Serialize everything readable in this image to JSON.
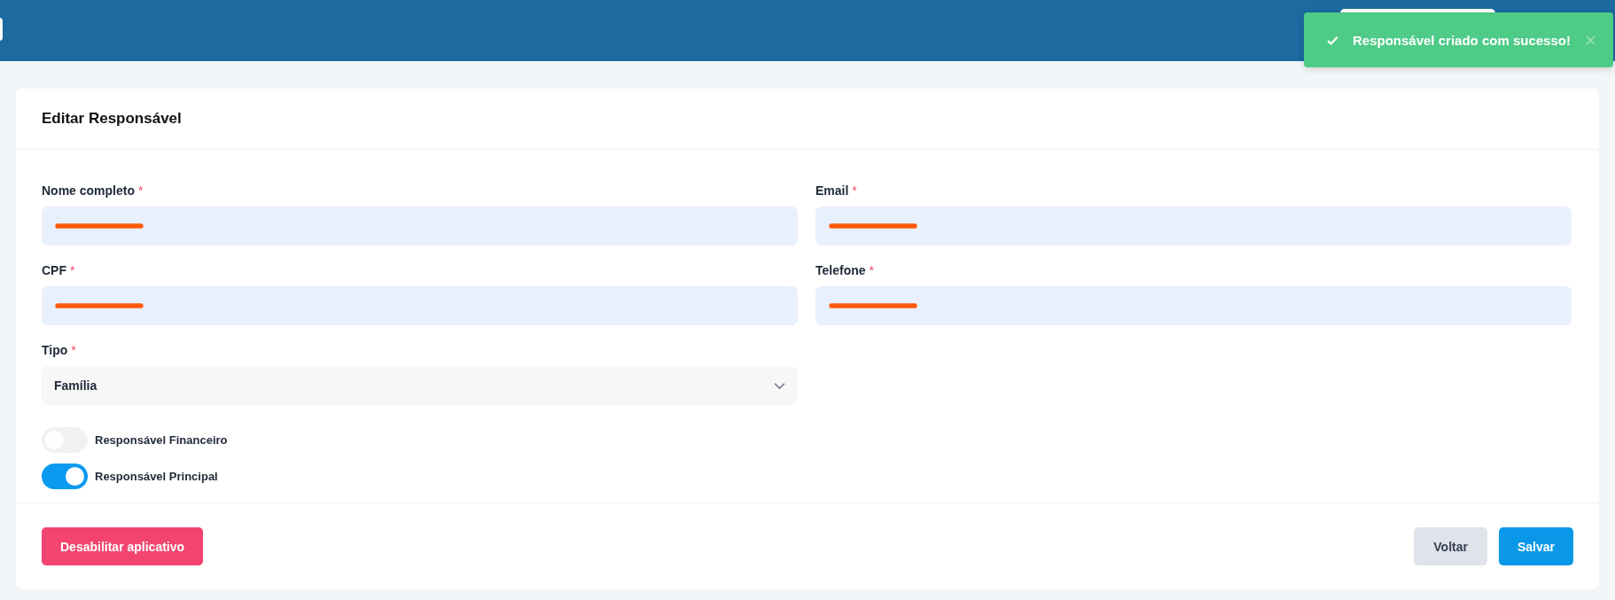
{
  "toast": {
    "message": "Responsável criado com sucesso!",
    "kind": "success"
  },
  "card": {
    "title": "Editar Responsável"
  },
  "fields": [
    {
      "label": "Nome completo",
      "required_mark": "*",
      "kind": "input",
      "redacted": true
    },
    {
      "label": "Email",
      "required_mark": "*",
      "kind": "input",
      "redacted": true
    },
    {
      "label": "CPF",
      "required_mark": "*",
      "kind": "input",
      "redacted": true
    },
    {
      "label": "Telefone",
      "required_mark": "*",
      "kind": "input",
      "redacted": true
    },
    {
      "label": "Tipo",
      "required_mark": "*",
      "kind": "select",
      "value": "Família"
    }
  ],
  "toggles": [
    {
      "label": "Responsável Financeiro",
      "on": false
    },
    {
      "label": "Responsável Principal",
      "on": true
    }
  ],
  "buttons": [
    {
      "label": "Desabilitar aplicativo",
      "kind": "danger"
    },
    {
      "label": "Voltar",
      "kind": "secondary"
    },
    {
      "label": "Salvar",
      "kind": "primary"
    }
  ]
}
